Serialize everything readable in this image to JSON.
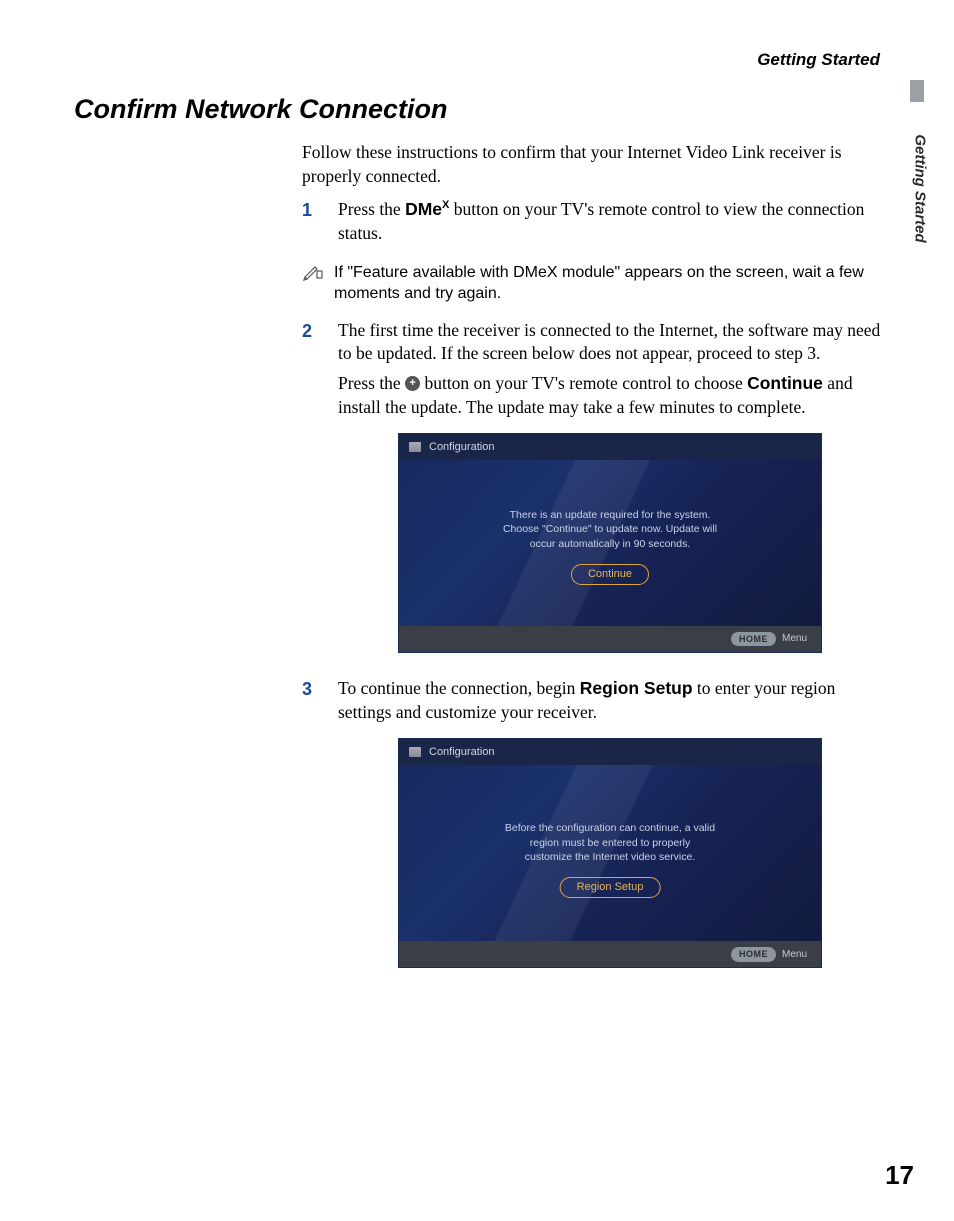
{
  "runningHead": "Getting Started",
  "sideTab": "Getting Started",
  "sectionTitle": "Confirm Network Connection",
  "intro": "Follow these instructions to confirm that your Internet Video Link receiver is properly connected.",
  "step1": {
    "num": "1",
    "pre": "Press the ",
    "dme_base": "DMe",
    "dme_sup": "X",
    "post": " button on your TV's remote control to view the connection status."
  },
  "note1": "If \"Feature available with DMeX module\" appears on the screen, wait a few moments and try again.",
  "step2": {
    "num": "2",
    "p1": "The first time the receiver is connected to the Internet, the software may need to be updated. If the screen below does not appear, proceed to step 3.",
    "p2_pre": "Press the ",
    "p2_mid": " button on your TV's remote control to choose ",
    "p2_bold": "Continue",
    "p2_post": " and install the update. The update may take a few minutes to complete."
  },
  "shot1": {
    "title": "Configuration",
    "msg_l1": "There is an update required for the system.",
    "msg_l2": "Choose \"Continue\" to update now. Update will",
    "msg_l3": "occur automatically in 90 seconds.",
    "cta": "Continue",
    "home": "HOME",
    "menu": "Menu"
  },
  "step3": {
    "num": "3",
    "pre": "To continue the connection, begin ",
    "bold": "Region Setup",
    "post": " to enter your region settings and customize your receiver."
  },
  "shot2": {
    "title": "Configuration",
    "msg_l1": "Before the configuration can continue, a valid",
    "msg_l2": "region must be entered to properly",
    "msg_l3": "customize the Internet video service.",
    "cta": "Region Setup",
    "home": "HOME",
    "menu": "Menu"
  },
  "pageNumber": "17"
}
